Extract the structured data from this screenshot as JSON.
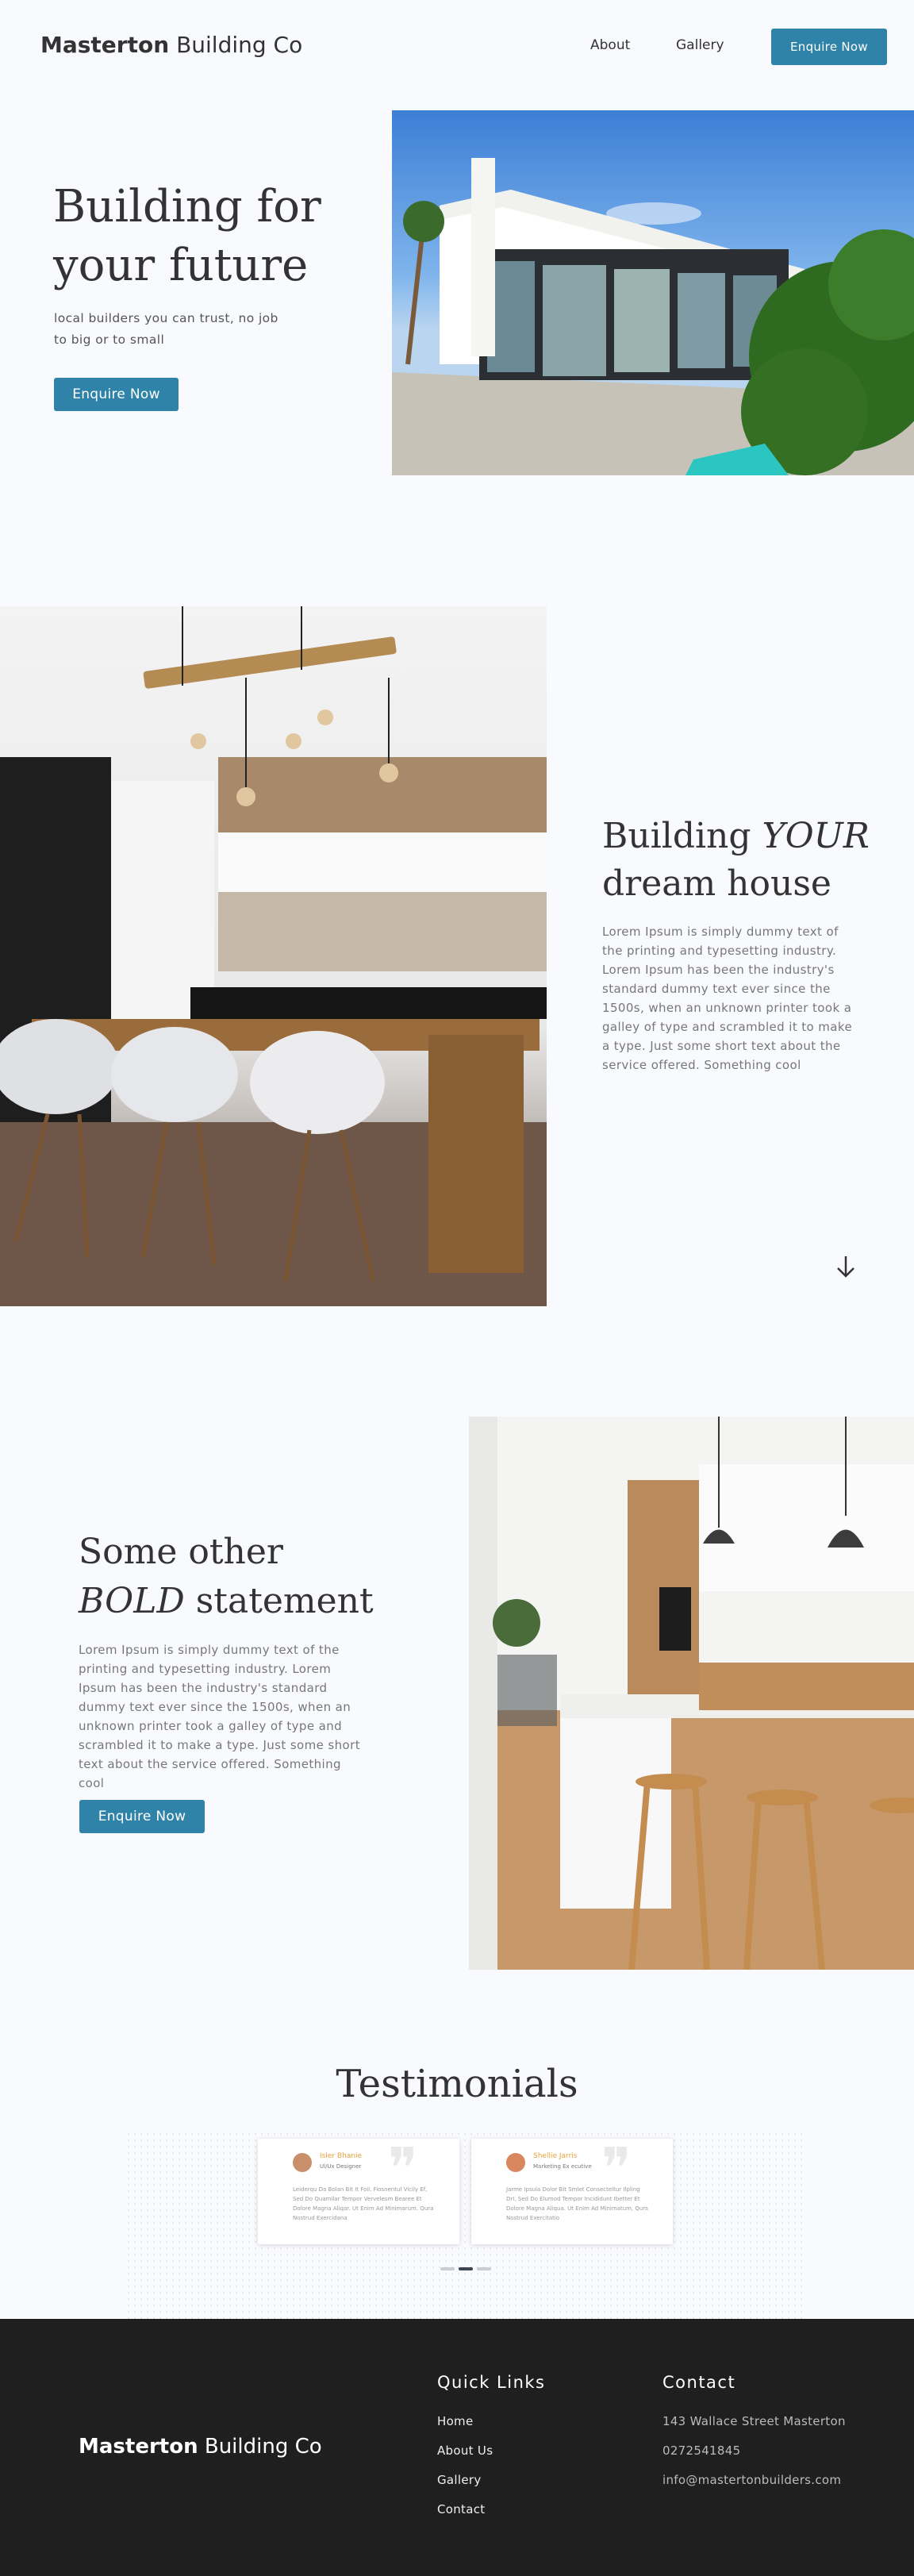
{
  "header": {
    "logo_bold": "Masterton",
    "logo_rest": " Building Co",
    "nav": [
      {
        "label": "About"
      },
      {
        "label": "Gallery"
      }
    ],
    "cta": "Enquire Now"
  },
  "hero": {
    "title_line1": "Building for",
    "title_line2": "your future",
    "subtitle": "local builders you can trust, no job to big or to small",
    "cta": "Enquire Now"
  },
  "section2": {
    "title_prefix": "Building ",
    "title_italic": "YOUR",
    "title_line2": "dream house",
    "body": "Lorem Ipsum is simply dummy text of the printing and typesetting industry. Lorem Ipsum has been the industry's standard dummy text ever since the 1500s, when an unknown printer took a galley of type and scrambled it to make a type. Just some short text about the service offered. Something cool",
    "arrow_icon": "arrow-down-icon"
  },
  "section3": {
    "title_line1": "Some other",
    "title_italic": "BOLD",
    "title_rest": " statement",
    "body": "Lorem Ipsum is simply dummy text of the printing and typesetting industry. Lorem Ipsum has been the industry's standard dummy text ever since the 1500s, when an unknown printer took a galley of type and scrambled it to make a type. Just some short text about the service offered. Something cool",
    "cta": "Enquire Now"
  },
  "testimonials": {
    "title": "Testimonials",
    "cards": [
      {
        "name": "Isler Bhanie",
        "role": "Ul/Ux Designer",
        "text": "Leiderqu Da Bolan Bit It Foil. Fiosnentul Vicily Ef, Sed Do Quamilar Tempor Vervelesm Bearee Et Dolore Magna Aliqar. Ut Enim Ad Minimarum. Qura Nostrud Exercidana"
      },
      {
        "name": "Shellie Jarris",
        "role": "Marketing Ex ecutive",
        "text": "Jarme Ipsula Dolor Bit Smlet Consecteltur Ilpling DrI, Sed Do Elumod Tempor Incididunt Ibetter Et Dolore Magna Aliqua. Ut Enim Ad Minimatum, Qurs Nostrud Exercitatio"
      }
    ]
  },
  "footer": {
    "logo_bold": "Masterton",
    "logo_rest": " Building Co",
    "quick_links_title": "Quick Links",
    "links": [
      {
        "label": "Home"
      },
      {
        "label": "About Us"
      },
      {
        "label": "Gallery"
      },
      {
        "label": "Contact"
      }
    ],
    "contact_title": "Contact",
    "address": "143 Wallace Street Masterton",
    "phone": "0272541845",
    "email": "info@mastertonbuilders.com"
  },
  "colors": {
    "accent": "#2f83a8",
    "footer_bg": "#1f1f1f",
    "page_bg": "#f9fafd"
  }
}
